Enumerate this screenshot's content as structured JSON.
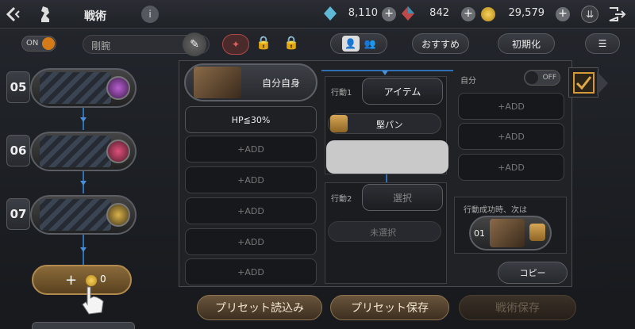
{
  "header": {
    "title": "戦術",
    "info_icon": "i",
    "blue_gem": "8,110",
    "red_gem": "842",
    "gold": "29,579"
  },
  "controls": {
    "toggle_label": "ON",
    "preset_name_placeholder": "剛腕",
    "recommend_label": "おすすめ",
    "reset_label": "初期化"
  },
  "steps": [
    {
      "num": "05"
    },
    {
      "num": "06"
    },
    {
      "num": "07"
    }
  ],
  "add_step": {
    "cost": "0"
  },
  "target": {
    "label": "自分自身"
  },
  "conditions": [
    {
      "label": "HP≦30%"
    },
    {
      "label": "+ADD"
    },
    {
      "label": "+ADD"
    },
    {
      "label": "+ADD"
    },
    {
      "label": "+ADD"
    },
    {
      "label": "+ADD"
    }
  ],
  "action1": {
    "label": "行動1",
    "type": "アイテム",
    "item": "堅パン"
  },
  "action2": {
    "label": "行動2",
    "select": "選択",
    "unselected": "未選択"
  },
  "self_panel": {
    "label": "自分",
    "toggle": "OFF",
    "adds": [
      "+ADD",
      "+ADD",
      "+ADD"
    ]
  },
  "next": {
    "label": "行動成功時、次は",
    "num": "01"
  },
  "copy_label": "コピー",
  "bottom": {
    "load": "プリセット読込み",
    "save": "プリセット保存",
    "tactic_save": "戦術保存"
  }
}
